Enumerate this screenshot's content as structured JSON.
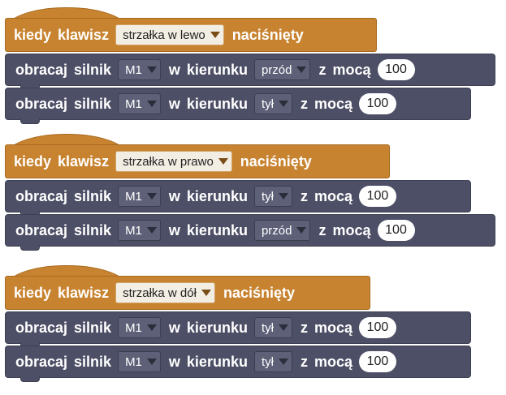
{
  "scripts": [
    {
      "hat": {
        "when_label": "kiedy",
        "key_label": "klawisz",
        "key_option": "strzałka w lewo",
        "pressed_label": "naciśnięty"
      },
      "blocks": [
        {
          "rotate_label": "obracaj",
          "motor_label": "silnik",
          "motor": "M1",
          "in_label": "w",
          "direction_label": "kierunku",
          "direction": "przód",
          "power_prefix": "z",
          "power_label": "mocą",
          "power": "100"
        },
        {
          "rotate_label": "obracaj",
          "motor_label": "silnik",
          "motor": "M1",
          "in_label": "w",
          "direction_label": "kierunku",
          "direction": "tył",
          "power_prefix": "z",
          "power_label": "mocą",
          "power": "100"
        }
      ]
    },
    {
      "hat": {
        "when_label": "kiedy",
        "key_label": "klawisz",
        "key_option": "strzałka w prawo",
        "pressed_label": "naciśnięty"
      },
      "blocks": [
        {
          "rotate_label": "obracaj",
          "motor_label": "silnik",
          "motor": "M1",
          "in_label": "w",
          "direction_label": "kierunku",
          "direction": "tył",
          "power_prefix": "z",
          "power_label": "mocą",
          "power": "100"
        },
        {
          "rotate_label": "obracaj",
          "motor_label": "silnik",
          "motor": "M1",
          "in_label": "w",
          "direction_label": "kierunku",
          "direction": "przód",
          "power_prefix": "z",
          "power_label": "mocą",
          "power": "100"
        }
      ]
    },
    {
      "hat": {
        "when_label": "kiedy",
        "key_label": "klawisz",
        "key_option": "strzałka w dół",
        "pressed_label": "naciśnięty"
      },
      "blocks": [
        {
          "rotate_label": "obracaj",
          "motor_label": "silnik",
          "motor": "M1",
          "in_label": "w",
          "direction_label": "kierunku",
          "direction": "tył",
          "power_prefix": "z",
          "power_label": "mocą",
          "power": "100"
        },
        {
          "rotate_label": "obracaj",
          "motor_label": "silnik",
          "motor": "M1",
          "in_label": "w",
          "direction_label": "kierunku",
          "direction": "tył",
          "power_prefix": "z",
          "power_label": "mocą",
          "power": "100"
        }
      ]
    }
  ],
  "colors": {
    "event_block": "#c88330",
    "motor_block": "#4d4f66",
    "background": "#ffffff"
  }
}
